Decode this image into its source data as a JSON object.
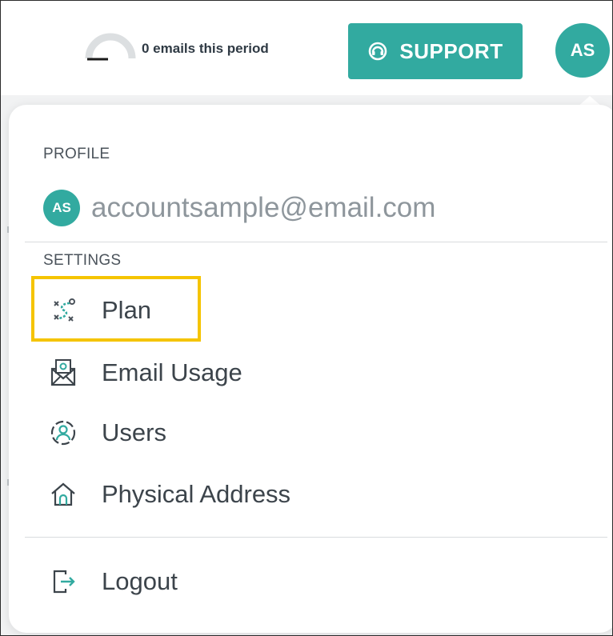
{
  "topbar": {
    "email_count_text": "0 emails this period",
    "support_label": "SUPPORT",
    "avatar_initials": "AS"
  },
  "menu": {
    "profile_label": "PROFILE",
    "profile_initials": "AS",
    "profile_email": "accountsample@email.com",
    "settings_label": "SETTINGS",
    "items": [
      {
        "label": "Plan",
        "icon": "plan-icon"
      },
      {
        "label": "Email Usage",
        "icon": "email-usage-icon"
      },
      {
        "label": "Users",
        "icon": "users-icon"
      },
      {
        "label": "Physical Address",
        "icon": "home-icon"
      }
    ],
    "logout_label": "Logout"
  },
  "colors": {
    "accent": "#32aaa0",
    "highlight": "#f5c400",
    "text": "#3c444b",
    "muted": "#8e969c"
  }
}
